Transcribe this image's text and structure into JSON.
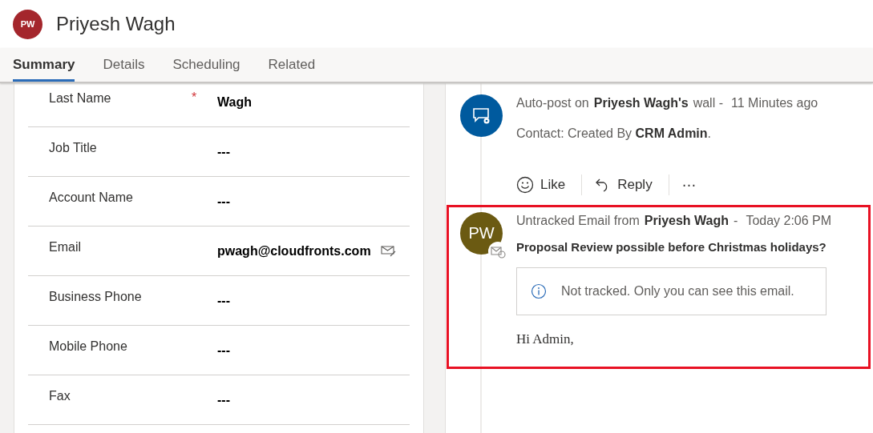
{
  "header": {
    "avatar_initials": "PW",
    "name": "Priyesh Wagh"
  },
  "required_marker": "*",
  "tabs": [
    {
      "label": "Summary",
      "selected": true
    },
    {
      "label": "Details",
      "selected": false
    },
    {
      "label": "Scheduling",
      "selected": false
    },
    {
      "label": "Related",
      "selected": false
    }
  ],
  "fields": [
    {
      "label": "Last Name",
      "required": true,
      "value": "Wagh",
      "kind": "text"
    },
    {
      "label": "Job Title",
      "required": false,
      "value": "---",
      "kind": "text"
    },
    {
      "label": "Account Name",
      "required": false,
      "value": "---",
      "kind": "text"
    },
    {
      "label": "Email",
      "required": false,
      "value": "pwagh@cloudfronts.com",
      "kind": "email"
    },
    {
      "label": "Business Phone",
      "required": false,
      "value": "---",
      "kind": "text"
    },
    {
      "label": "Mobile Phone",
      "required": false,
      "value": "---",
      "kind": "text"
    },
    {
      "label": "Fax",
      "required": false,
      "value": "---",
      "kind": "text"
    }
  ],
  "timeline": [
    {
      "kind": "auto-post",
      "prefix": "Auto-post on",
      "author": "Priyesh Wagh's",
      "suffix": "wall -",
      "time": "11 Minutes ago",
      "body": "Contact: Created By **CRM Admin**.",
      "actions": [
        "Like",
        "Reply",
        "⋯"
      ],
      "highlighted": false
    },
    {
      "kind": "email",
      "avatar_initials": "PW",
      "prefix": "Untracked Email from",
      "author": "Priyesh Wagh",
      "suffix": "-",
      "time": "Today 2:06 PM",
      "subject": "Proposal Review possible before Christmas holidays?",
      "notice": "Not tracked. Only you can see this email.",
      "body": "Hi Admin,",
      "highlighted": true
    }
  ]
}
